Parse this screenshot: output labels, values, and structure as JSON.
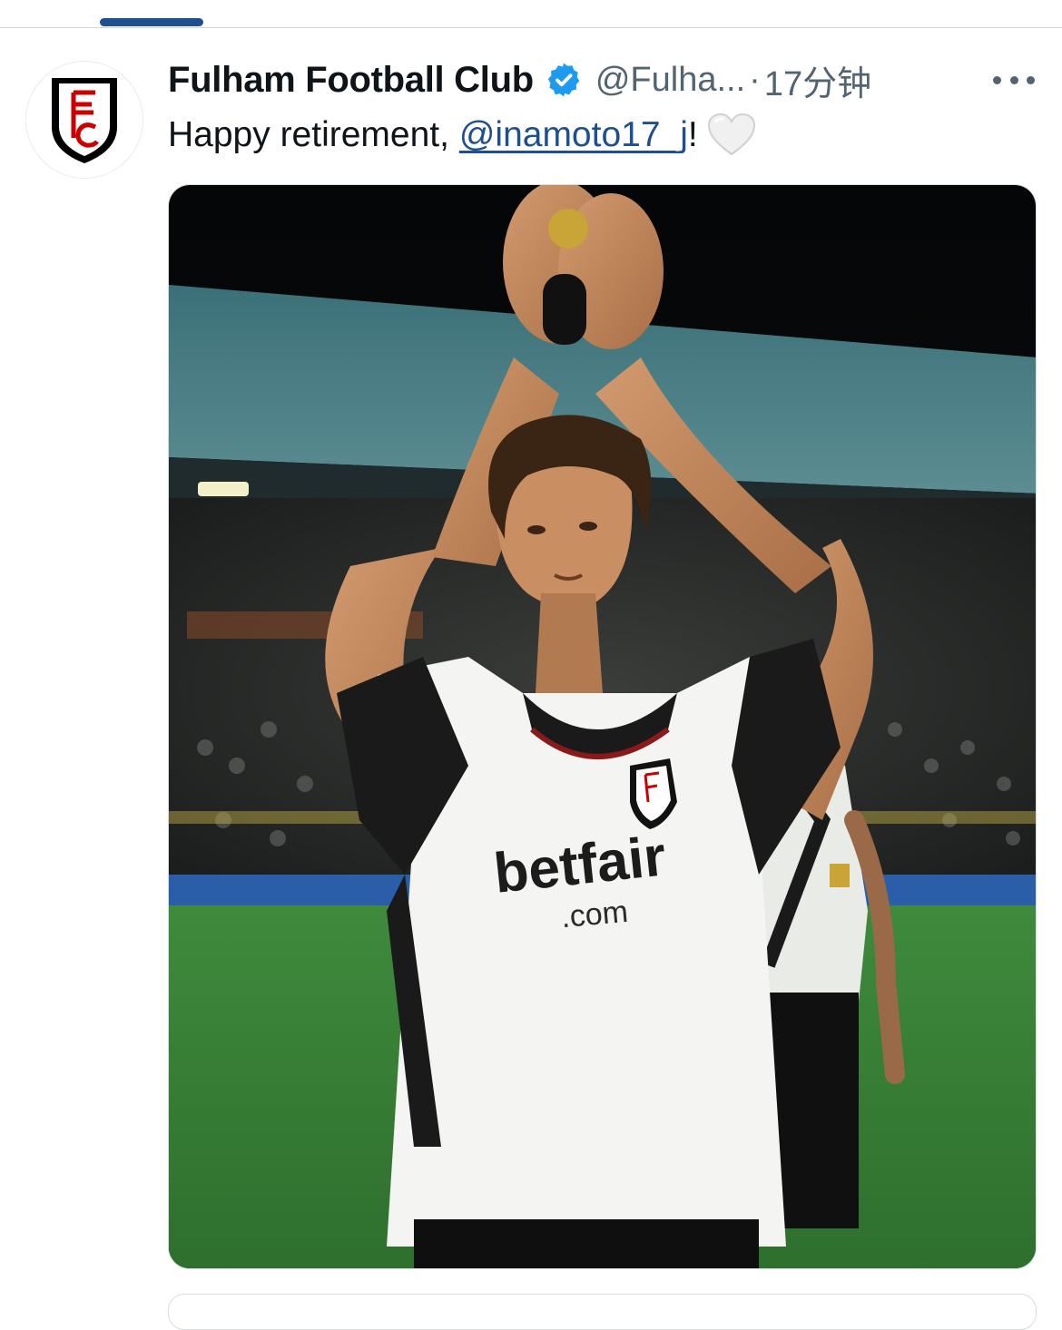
{
  "tabs": {
    "active_index": 0
  },
  "tweet": {
    "author_name": "Fulham Football Club",
    "verified": true,
    "handle": "@Fulha...",
    "separator": "·",
    "time": "17分钟",
    "text_prefix": "Happy retirement, ",
    "mention": "@inamoto17_j",
    "text_suffix": "!",
    "emoji": "white-heart-icon",
    "media": {
      "description_icon": "photo",
      "shirt_sponsor": "betfair",
      "shirt_sponsor_suffix": ".com",
      "crest_letters": "FFC"
    }
  },
  "colors": {
    "accent": "#1d4f91",
    "text": "#0f1419",
    "secondary": "#536471",
    "verified_badge": "#1d9bf0",
    "fulham_red": "#cc0000"
  }
}
